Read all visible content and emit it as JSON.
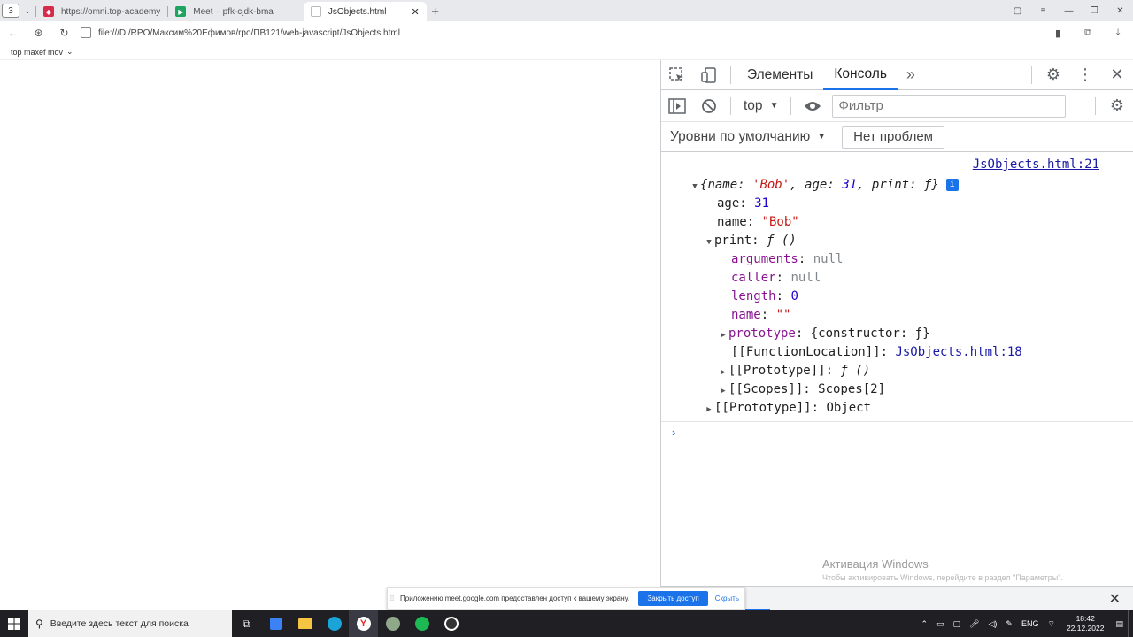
{
  "browser": {
    "tab_counter": "3",
    "tabs": [
      {
        "title": "https://omni.top-academy",
        "active": false,
        "favicon_color": "#d62b4b"
      },
      {
        "title": "Meet – pfk-cjdk-bma",
        "active": false,
        "favicon_color": "#1ea362"
      },
      {
        "title": "JsObjects.html",
        "active": true,
        "favicon_color": "#c9c9c9"
      }
    ],
    "url": "file:///D:/RPO/Максим%20Ефимов/rpo/ПВ121/web-javascript/JsObjects.html",
    "bookmark_label": "top maxef mov"
  },
  "devtools": {
    "tabs": {
      "elements": "Элементы",
      "console": "Консоль"
    },
    "context": "top",
    "filter_placeholder": "Фильтр",
    "levels": "Уровни по умолчанию",
    "issues": "Нет проблем",
    "source_link": "JsObjects.html:21",
    "object_preview": {
      "open": "{",
      "name_key": "name",
      "name_val": "'Bob'",
      "age_key": "age",
      "age_val": "31",
      "print_key": "print",
      "print_val": "ƒ",
      "close": "}"
    },
    "props": {
      "age_key": "age",
      "age_val": "31",
      "name_key": "name",
      "name_val": "\"Bob\"",
      "print_key": "print",
      "print_val": "ƒ ()",
      "arguments_key": "arguments",
      "arguments_val": "null",
      "caller_key": "caller",
      "caller_val": "null",
      "length_key": "length",
      "length_val": "0",
      "fname_key": "name",
      "fname_val": "\"\"",
      "prototype_key": "prototype",
      "prototype_val": "{constructor: ƒ}",
      "funcloc_key": "[[FunctionLocation]]",
      "funcloc_val": "JsObjects.html:18",
      "fproto_key": "[[Prototype]]",
      "fproto_val": "ƒ ()",
      "scopes_key": "[[Scopes]]",
      "scopes_val": "Scopes[2]",
      "oproto_key": "[[Prototype]]",
      "oproto_val": "Object"
    },
    "drawer_tab": "ль",
    "watermark_title": "Активация Windows",
    "watermark_sub": "Чтобы активировать Windows, перейдите в раздел \"Параметры\"."
  },
  "share_bar": {
    "text": "Приложению meet.google.com предоставлен доступ к вашему экрану.",
    "stop": "Закрыть доступ",
    "hide": "Скрыть"
  },
  "taskbar": {
    "search_placeholder": "Введите здесь текст для поиска",
    "lang": "ENG",
    "time": "18:42",
    "date": "22.12.2022"
  }
}
